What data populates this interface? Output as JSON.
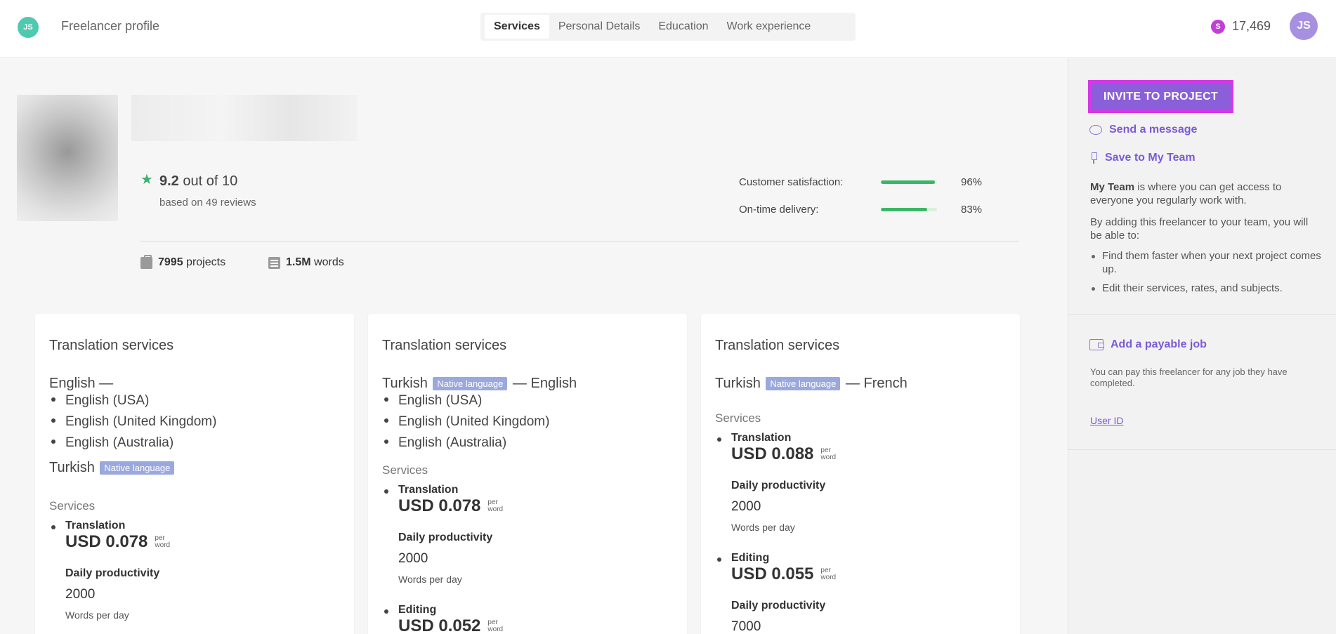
{
  "header": {
    "logo_text": "JS",
    "app_title": "Freelancer profile",
    "tabs": [
      {
        "label": "Services",
        "active": true
      },
      {
        "label": "Personal Details",
        "active": false
      },
      {
        "label": "Education",
        "active": false
      },
      {
        "label": "Work experience",
        "active": false
      }
    ],
    "balance_icon": "S",
    "balance": "17,469",
    "avatar_initials": "JS"
  },
  "profile": {
    "rating_value": "9.2",
    "rating_suffix": "out of 10",
    "rating_sub": "based on 49 reviews",
    "metrics": [
      {
        "label": "Customer satisfaction:",
        "percent": "96%",
        "value": 0.96
      },
      {
        "label": "On-time delivery:",
        "percent": "83%",
        "value": 0.83
      }
    ],
    "projects_count": "7995",
    "projects_label": "projects",
    "words_count": "1.5M",
    "words_label": "words"
  },
  "cards": [
    {
      "title": "Translation services",
      "source": "English —",
      "sub_langs": [
        "English (USA)",
        "English (United Kingdom)",
        "English (Australia)"
      ],
      "target": "Turkish",
      "native_badge": "Native language",
      "services_heading": "Services",
      "services": [
        {
          "name": "Translation",
          "rate": "USD 0.078",
          "per": "per",
          "unit": "word",
          "dp_heading": "Daily productivity",
          "dp_value": "2000",
          "dp_unit": "Words per day"
        }
      ]
    },
    {
      "title": "Translation services",
      "source": "Turkish",
      "native_badge": "Native language",
      "target_suffix": "— English",
      "sub_langs": [
        "English (USA)",
        "English (United Kingdom)",
        "English (Australia)"
      ],
      "services_heading": "Services",
      "services": [
        {
          "name": "Translation",
          "rate": "USD 0.078",
          "per": "per",
          "unit": "word",
          "dp_heading": "Daily productivity",
          "dp_value": "2000",
          "dp_unit": "Words per day"
        },
        {
          "name": "Editing",
          "rate": "USD 0.052",
          "per": "per",
          "unit": "word"
        }
      ]
    },
    {
      "title": "Translation services",
      "source": "Turkish",
      "native_badge": "Native language",
      "target_suffix": "— French",
      "services_heading": "Services",
      "services": [
        {
          "name": "Translation",
          "rate": "USD 0.088",
          "per": "per",
          "unit": "word",
          "dp_heading": "Daily productivity",
          "dp_value": "2000",
          "dp_unit": "Words per day"
        },
        {
          "name": "Editing",
          "rate": "USD 0.055",
          "per": "per",
          "unit": "word",
          "dp_heading": "Daily productivity",
          "dp_value": "7000"
        }
      ]
    }
  ],
  "sidebar": {
    "invite_label": "INVITE TO PROJECT",
    "send_message": "Send a message",
    "save_team": "Save to My Team",
    "my_team_bold": "My Team",
    "my_team_text": " is where you can get access to everyone you regularly work with.",
    "adding_text": "By adding this freelancer to your team, you will be able to:",
    "bullets": [
      "Find them faster when your next project comes up.",
      "Edit their services, rates, and subjects."
    ],
    "add_job": "Add a payable job",
    "pay_text": "You can pay this freelancer for any job they have completed.",
    "user_id": "User ID"
  }
}
